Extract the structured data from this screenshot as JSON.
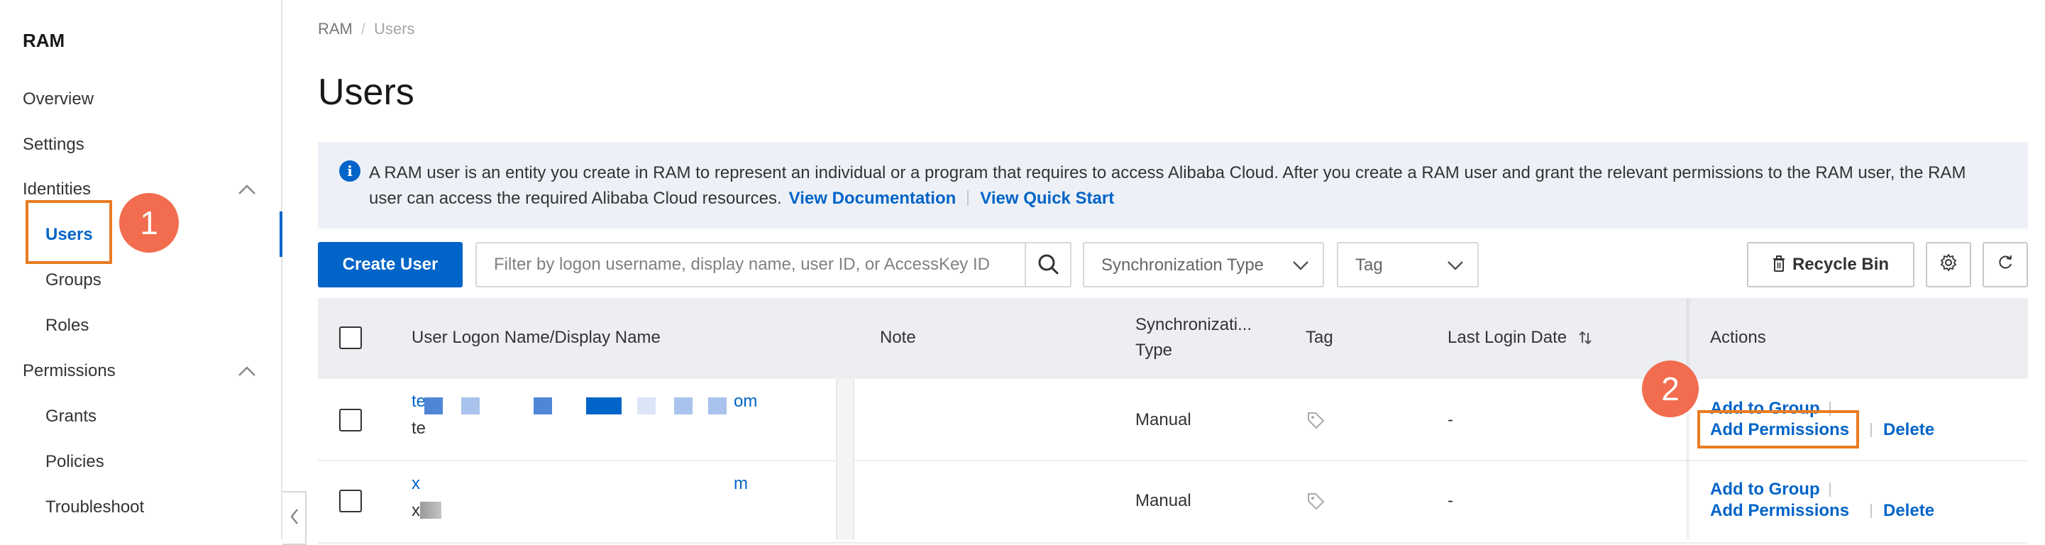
{
  "sidebar": {
    "title": "RAM",
    "items": [
      {
        "label": "Overview"
      },
      {
        "label": "Settings"
      },
      {
        "label": "Identities"
      },
      {
        "label": "Users"
      },
      {
        "label": "Groups"
      },
      {
        "label": "Roles"
      },
      {
        "label": "Permissions"
      },
      {
        "label": "Grants"
      },
      {
        "label": "Policies"
      },
      {
        "label": "Troubleshoot"
      }
    ],
    "active_item": "Users"
  },
  "annotations": {
    "step1": "1",
    "step2": "2"
  },
  "breadcrumb": {
    "root": "RAM",
    "separator": "/",
    "current": "Users"
  },
  "page_title": "Users",
  "notice": {
    "text": "A RAM user is an entity you create in RAM to represent an individual or a program that requires to access Alibaba Cloud. After you create a RAM user and grant the relevant permissions to the RAM user, the RAM user can access the required Alibaba Cloud resources.",
    "link_docs": "View Documentation",
    "link_quickstart": "View Quick Start"
  },
  "toolbar": {
    "create_label": "Create User",
    "search_placeholder": "Filter by logon username, display name, user ID, or AccessKey ID",
    "sync_type_label": "Synchronization Type",
    "tag_label": "Tag",
    "recycle_label": "Recycle Bin"
  },
  "table": {
    "columns": {
      "name": "User Logon Name/Display Name",
      "note": "Note",
      "sync_line1": "Synchronizati...",
      "sync_line2": "Type",
      "tag": "Tag",
      "last_login": "Last Login Date",
      "actions": "Actions"
    },
    "rows": [
      {
        "logon_start": "te",
        "logon_end": "om",
        "display": "te",
        "note": "",
        "sync_type": "Manual",
        "last_login": "-",
        "actions": [
          "Add to Group",
          "Add Permissions",
          "Delete"
        ]
      },
      {
        "logon_start": "x",
        "logon_end": "m",
        "display": "x",
        "note": "",
        "sync_type": "Manual",
        "last_login": "-",
        "actions": [
          "Add to Group",
          "Add Permissions",
          "Delete"
        ]
      }
    ]
  },
  "colors": {
    "accent": "#0064c8",
    "highlight": "#ea7b22",
    "badge": "#f26c4f"
  }
}
